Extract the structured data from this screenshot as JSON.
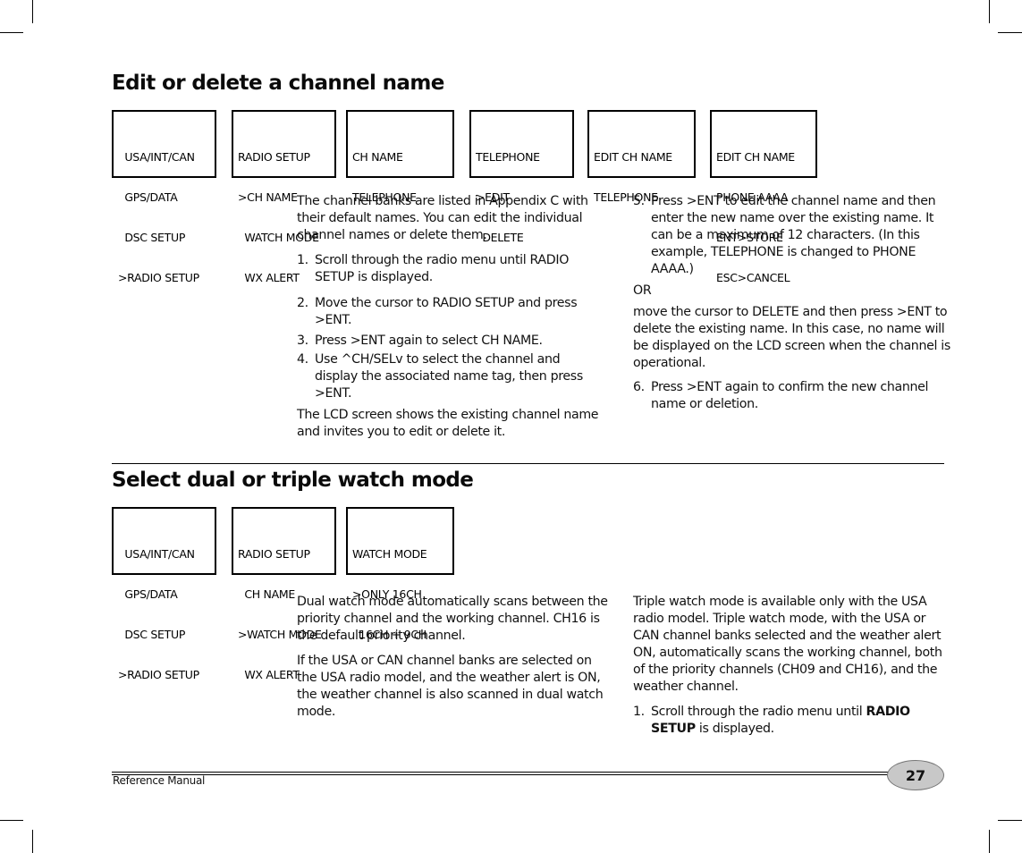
{
  "sections": [
    {
      "title": "Edit or delete a channel name",
      "lcd_screens": [
        [
          "  USA/INT/CAN",
          "  GPS/DATA",
          "  DSC SETUP",
          ">RADIO SETUP"
        ],
        [
          "RADIO SETUP",
          ">CH NAME",
          "  WATCH MODE",
          "  WX ALERT"
        ],
        [
          "CH NAME",
          "TELEPHONE"
        ],
        [
          "TELEPHONE",
          ">EDIT",
          "  DELETE"
        ],
        [
          "EDIT CH NAME",
          "TELEPHONE"
        ],
        [
          "EDIT CH NAME",
          "PHONE AAAA",
          "ENT>STORE",
          "ESC>CANCEL"
        ]
      ],
      "left_column": {
        "intro": "The channel banks are listed in Appendix C with their default names. You can edit the individual channel names or delete them.",
        "steps": [
          {
            "num": "1.",
            "text": "Scroll through the radio menu until RADIO SETUP is displayed."
          },
          {
            "num": "2.",
            "text": "Move the cursor to RADIO SETUP and press >ENT."
          },
          {
            "num": "3.",
            "text": "Press >ENT again to select CH NAME."
          },
          {
            "num": "4.",
            "text": "Use ^CH/SELv to select the channel and display the associated name tag, then press >ENT."
          }
        ],
        "note": "The LCD screen shows the existing channel name and invites you to edit or delete it."
      },
      "right_column": {
        "steps": [
          {
            "num": "5.",
            "text": "Press >ENT to edit the channel name and then enter the new name over the existing name. It can be a maximum of 12 characters. (In this example, TELEPHONE is changed to PHONE AAAA.)"
          }
        ],
        "or_label": "OR",
        "alt_text": "move the cursor to DELETE and then press >ENT to delete the existing name. In this case, no name will be displayed on the LCD screen when the channel is operational.",
        "final_step": {
          "num": "6.",
          "text": "Press >ENT again to confirm the new channel name or deletion."
        }
      }
    },
    {
      "title": "Select dual or triple watch mode",
      "lcd_screens": [
        [
          "  USA/INT/CAN",
          "  GPS/DATA",
          "  DSC SETUP",
          ">RADIO SETUP"
        ],
        [
          "RADIO SETUP",
          "  CH NAME",
          ">WATCH MODE",
          "  WX ALERT"
        ],
        [
          "WATCH MODE",
          ">ONLY 16CH",
          "  16CH + 9CH"
        ]
      ],
      "left_column": {
        "paragraphs": [
          "Dual watch mode automatically scans between the priority channel and the working channel. CH16 is the default priority channel.",
          "If the USA or CAN channel banks are selected on the USA radio model, and the weather alert is ON, the weather channel is also scanned in dual watch mode."
        ]
      },
      "right_column": {
        "paragraph": "Triple watch mode is available only with the USA radio model. Triple watch mode, with the USA or CAN channel banks selected and the weather alert ON, automatically scans the working channel, both of the priority channels (CH09 and CH16), and the weather channel.",
        "step": {
          "num": "1.",
          "pre": "Scroll through the radio menu until ",
          "bold": "RADIO SETUP",
          "post": " is displayed."
        }
      }
    }
  ],
  "footer": {
    "label": "Reference Manual",
    "page_number": "27"
  },
  "colors": {
    "page_badge_fill": "#c8c8c8",
    "text": "#111111"
  }
}
